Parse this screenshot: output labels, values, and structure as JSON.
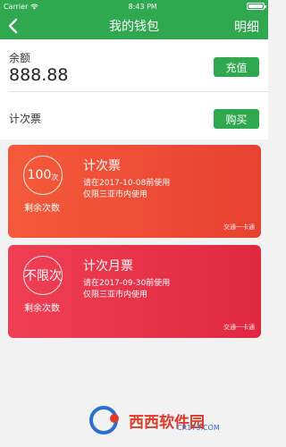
{
  "statusbar": {
    "carrier": "Carrier",
    "time": "8:43 PM"
  },
  "nav": {
    "title": "我的钱包",
    "detail": "明细"
  },
  "wallet": {
    "balance_label": "余额",
    "balance_value": "888.88",
    "recharge_label": "充值",
    "ticket_label": "计次票",
    "buy_label": "购买"
  },
  "cards": [
    {
      "count": "100",
      "unit": "次",
      "remain_label": "剩余次数",
      "name": "计次票",
      "line1": "请在2017-10-08前使用",
      "line2": "仅限三亚市内使用",
      "issuer": "交通一卡通"
    },
    {
      "count": "不限次",
      "remain_label": "剩余次数",
      "name": "计次月票",
      "line1": "请在2017-09-30前使用",
      "line2": "仅限三亚市内使用",
      "issuer": "交通一卡通"
    }
  ],
  "watermark": {
    "text": "西西软件园",
    "url": "CR173.COM"
  },
  "icons": {
    "back": "chevron-left-icon",
    "wifi": "wifi-icon",
    "battery": "battery-icon"
  },
  "colors": {
    "brand_green": "#2fa84f",
    "card1_orange_red": "#f45a3a",
    "card2_red": "#e0283f"
  }
}
